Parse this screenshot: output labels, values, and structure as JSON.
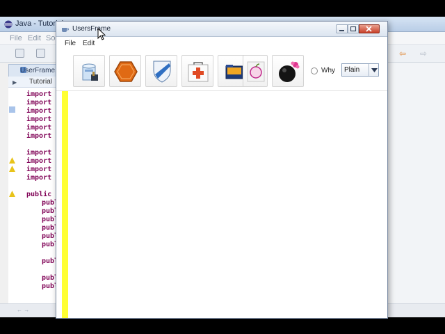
{
  "ide": {
    "title": "Java - Tutorial",
    "menus": [
      "File",
      "Edit",
      "So"
    ],
    "editor_tab": "UserFrame.j",
    "outline_label": "Tutorial",
    "code_lines": [
      "import",
      "import",
      "import",
      "import",
      "import",
      "import",
      "import",
      "import",
      "import",
      "import",
      "public c",
      "publ",
      "publ",
      "publ",
      "publ",
      "publ",
      "publ",
      "publ",
      "publ",
      "publ"
    ],
    "status_text": "← →"
  },
  "window": {
    "title": "UsersFrame",
    "menus": {
      "file": "File",
      "edit": "Edit"
    },
    "toolbar": {
      "buttons": [
        {
          "name": "database-icon"
        },
        {
          "name": "hexagon-icon"
        },
        {
          "name": "shield-icon"
        },
        {
          "name": "first-aid-kit-icon"
        },
        {
          "name": "folder-icon"
        },
        {
          "name": "apple-icon"
        },
        {
          "name": "bomb-icon"
        }
      ],
      "radio_label": "Why",
      "combo_value": "Plain"
    }
  },
  "colors": {
    "highlight_bar": "#ffff33",
    "close_button": "#c8412b",
    "hexagon": "#e06a14"
  }
}
